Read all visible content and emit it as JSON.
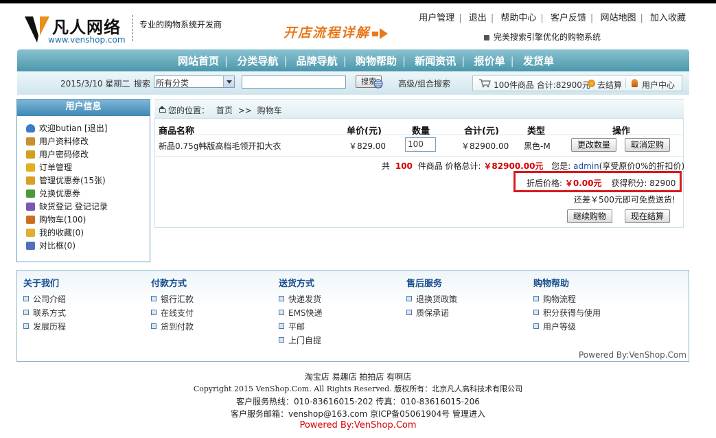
{
  "header": {
    "logo_name": "凡人网络",
    "logo_url": "www.venshop.com",
    "slogan": "专业的购物系统开发商",
    "flow_banner": "开店流程详解",
    "top_links": [
      "用户管理",
      "退出",
      "帮助中心",
      "客户反馈",
      "网站地图",
      "加入收藏"
    ],
    "notice": "完美搜索引擎优化的购物系统"
  },
  "nav": {
    "menu": [
      "网站首页",
      "分类导航",
      "品牌导航",
      "购物帮助",
      "新闻资讯",
      "报价单",
      "发货单"
    ],
    "date": "2015/3/10 星期二",
    "search_label": "搜索",
    "category_selected": "所有分类",
    "keyword_value": "",
    "search_button": "搜索",
    "advanced_search": "高级/组合搜索",
    "cart_summary": "100件商品 合计:82900元",
    "checkout": "去结算",
    "user_center": "用户中心"
  },
  "sidebar": {
    "title": "用户信息",
    "items": [
      {
        "label": "欢迎butian [退出]",
        "icon": "user-icon",
        "color": "#3a7cc8"
      },
      {
        "label": "用户资料修改",
        "icon": "profile-icon",
        "color": "#c89030"
      },
      {
        "label": "用户密码修改",
        "icon": "lock-icon",
        "color": "#d0a020"
      },
      {
        "label": "订单管理",
        "icon": "order-icon",
        "color": "#e0b020"
      },
      {
        "label": "管理优惠券(15张)",
        "icon": "coupon-icon",
        "color": "#d8a028"
      },
      {
        "label": "兑换优惠券",
        "icon": "exchange-icon",
        "color": "#4a9a3a"
      },
      {
        "label": "缺货登记 登记记录",
        "icon": "register-icon",
        "color": "#7a5ab0"
      },
      {
        "label": "购物车(100)",
        "icon": "cart-icon",
        "color": "#c87020"
      },
      {
        "label": "我的收藏(0)",
        "icon": "folder-icon",
        "color": "#e0b030"
      },
      {
        "label": "对比框(0)",
        "icon": "chart-icon",
        "color": "#5070b8"
      }
    ]
  },
  "breadcrumb": {
    "prefix": "您的位置：",
    "home": "首页",
    "sep": ">>",
    "current": "购物车"
  },
  "cart_table": {
    "headers": [
      "商品名称",
      "单价(元)",
      "数量",
      "合计(元)",
      "类型",
      "操作"
    ],
    "rows": [
      {
        "name": "新品0.75g韩版高档毛领开扣大衣",
        "price": "￥829.00",
        "qty": "100",
        "subtotal": "￥82900.00",
        "type": "黑色-M",
        "update_btn": "更改数量",
        "cancel_btn": "取消定购"
      }
    ]
  },
  "summary": {
    "count_prefix": "共",
    "count": "100",
    "count_suffix": "件商品 价格总计:",
    "total": "￥82900.00元",
    "member_prefix": "您是:",
    "member": "admin",
    "member_note": "(享受原价0%的折扣价)",
    "discount_label": "折后价格:",
    "discount_value": "￥0.00元",
    "points_label": "获得积分:",
    "points_value": "82900",
    "free_ship": "还差￥500元即可免费送货!",
    "continue_btn": "继续购物",
    "checkout_btn": "现在结算"
  },
  "footer_columns": [
    {
      "title": "关于我们",
      "items": [
        "公司介绍",
        "联系方式",
        "发展历程"
      ]
    },
    {
      "title": "付款方式",
      "items": [
        "银行汇款",
        "在线支付",
        "货到付款"
      ]
    },
    {
      "title": "送货方式",
      "items": [
        "快递发货",
        "EMS快递",
        "平邮",
        "上门自提"
      ]
    },
    {
      "title": "售后服务",
      "items": [
        "退换货政策",
        "质保承诺"
      ]
    },
    {
      "title": "购物帮助",
      "items": [
        "购物流程",
        "积分获得与使用",
        "用户等级"
      ]
    }
  ],
  "footer": {
    "powered_box": "Powered By:VenShop.Com",
    "links": "淘宝店 易趣店 拍拍店 有啊店",
    "copyright": "Copyright 2015 VenShop.Com. All Rights Reserved. 版权所有：北京凡人高科技术有限公司",
    "hotline": "客户服务热线：010-83616015-202 传真：010-83616015-206",
    "email": "客户服务邮箱：venshop@163.com 京ICP备05061904号 管理进入",
    "powered": "Powered By:VenShop.Com"
  },
  "colors": {
    "accent": "#e8781c",
    "highlight": "#d8191f",
    "nav": "#4b97ab",
    "footer_title": "#174e8c"
  }
}
